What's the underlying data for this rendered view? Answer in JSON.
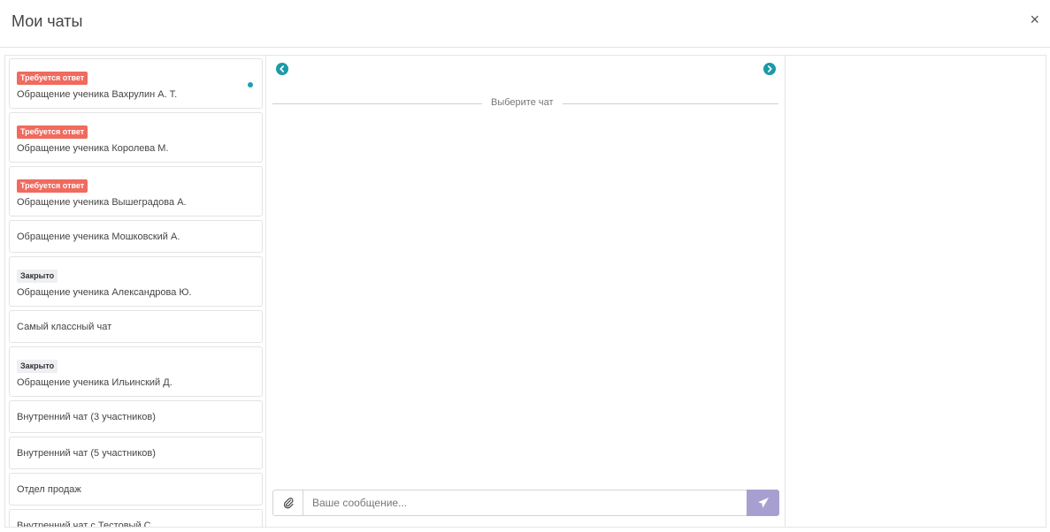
{
  "header": {
    "title": "Мои чаты",
    "close_label": "×"
  },
  "chats": [
    {
      "badge": "Требуется ответ",
      "badge_type": "red",
      "name": "Обращение ученика Вахрулин А. Т.",
      "unread": true
    },
    {
      "badge": "Требуется ответ",
      "badge_type": "red",
      "name": "Обращение ученика Королева М.",
      "unread": false
    },
    {
      "badge": "Требуется ответ",
      "badge_type": "red",
      "name": "Обращение ученика Вышеградова А.",
      "unread": false
    },
    {
      "badge": "",
      "badge_type": "",
      "name": "Обращение ученика Мошковский А.",
      "unread": false
    },
    {
      "badge": "Закрыто",
      "badge_type": "grey",
      "name": "Обращение ученика Александрова Ю.",
      "unread": false
    },
    {
      "badge": "",
      "badge_type": "",
      "name": "Самый классный чат",
      "unread": false
    },
    {
      "badge": "Закрыто",
      "badge_type": "grey",
      "name": "Обращение ученика Ильинский Д.",
      "unread": false
    },
    {
      "badge": "",
      "badge_type": "",
      "name": "Внутренний чат (3 участников)",
      "unread": false
    },
    {
      "badge": "",
      "badge_type": "",
      "name": "Внутренний чат (5 участников)",
      "unread": false
    },
    {
      "badge": "",
      "badge_type": "",
      "name": "Отдел продаж",
      "unread": false
    },
    {
      "badge": "",
      "badge_type": "",
      "name": "Внутренний чат с Тестовый С.",
      "unread": false
    }
  ],
  "chat_area": {
    "empty_label": "Выберите чат"
  },
  "composer": {
    "placeholder": "Ваше сообщение..."
  },
  "colors": {
    "accent": "#1b9aa8",
    "badge_required": "#f06a5e",
    "badge_closed": "#eeeff2",
    "send_button": "#a79fcf"
  },
  "icons": {
    "prev": "chevron-left-icon",
    "next": "chevron-right-icon",
    "attach": "paperclip-icon",
    "send": "paper-plane-icon",
    "close": "close-icon"
  }
}
